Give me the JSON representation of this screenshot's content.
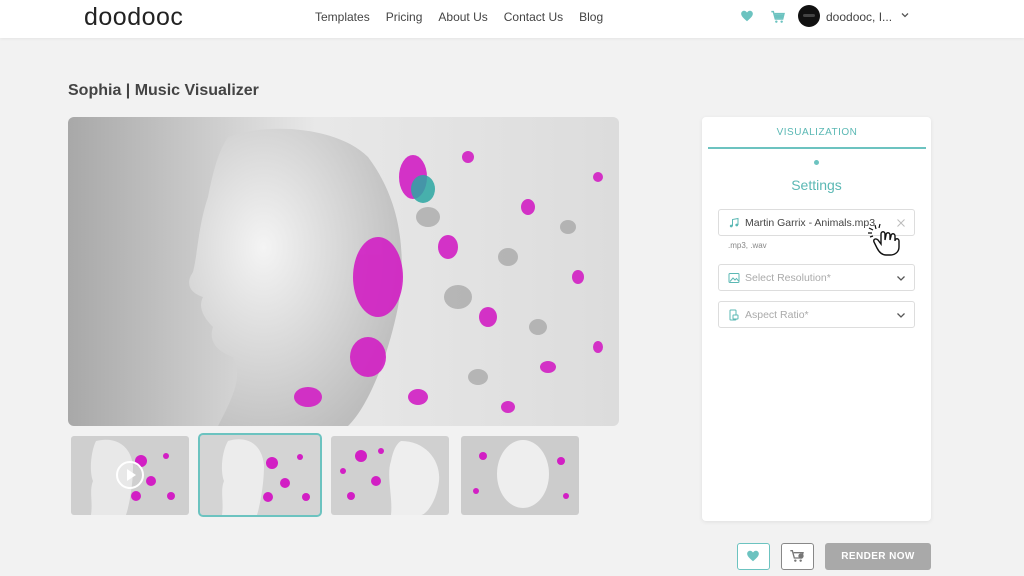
{
  "header": {
    "logo": "doodooc",
    "nav": [
      "Templates",
      "Pricing",
      "About Us",
      "Contact Us",
      "Blog"
    ],
    "user_name": "doodooc, I...",
    "accent": "#6cc3c0"
  },
  "page": {
    "title": "Sophia | Music Visualizer"
  },
  "panel": {
    "tab_label": "VISUALIZATION",
    "heading": "Settings",
    "audio_file": "Martin Garrix - Animals.mp3",
    "audio_hint": ".mp3, .wav",
    "resolution_placeholder": "Select Resolution*",
    "aspect_placeholder": "Aspect Ratio*"
  },
  "actions": {
    "render_label": "RENDER NOW"
  }
}
